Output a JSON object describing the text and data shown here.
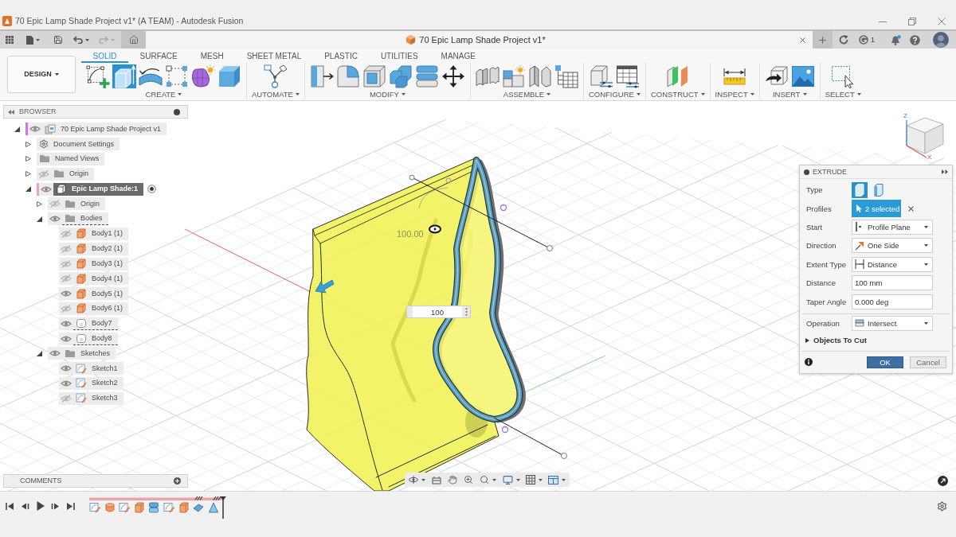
{
  "window": {
    "title": "70 Epic Lamp Shade Project v1* (A TEAM) - Autodesk Fusion"
  },
  "quick_access": {
    "undo": {
      "disabled": false
    },
    "redo": {
      "disabled": true
    }
  },
  "document_tab": {
    "title": "70 Epic Lamp Shade Project v1*"
  },
  "header_right": {
    "job_count": "1"
  },
  "workspace": {
    "label": "DESIGN"
  },
  "toolbar_tabs": [
    {
      "label": "SOLID",
      "selected": true
    },
    {
      "label": "SURFACE",
      "selected": false
    },
    {
      "label": "MESH",
      "selected": false
    },
    {
      "label": "SHEET METAL",
      "selected": false
    },
    {
      "label": "PLASTIC",
      "selected": false
    },
    {
      "label": "UTILITIES",
      "selected": false
    },
    {
      "label": "MANAGE",
      "selected": false
    }
  ],
  "tool_groups": [
    {
      "label": "CREATE",
      "tools": [
        {
          "kind": "sketch",
          "selected": false
        },
        {
          "kind": "extrude",
          "selected": true
        },
        {
          "kind": "revolve",
          "selected": false
        },
        {
          "kind": "pattern",
          "selected": false
        },
        {
          "kind": "form",
          "selected": false
        },
        {
          "kind": "box",
          "selected": false
        }
      ]
    },
    {
      "label": "AUTOMATE",
      "tools": [
        {
          "kind": "automate",
          "selected": false
        }
      ]
    },
    {
      "label": "MODIFY",
      "tools": [
        {
          "kind": "presspull",
          "selected": false
        },
        {
          "kind": "fillet",
          "selected": false
        },
        {
          "kind": "shell",
          "selected": false
        },
        {
          "kind": "combine",
          "selected": false
        },
        {
          "kind": "split",
          "selected": false
        },
        {
          "kind": "move",
          "selected": false
        }
      ]
    },
    {
      "label": "ASSEMBLE",
      "tools": [
        {
          "kind": "joint",
          "selected": false
        },
        {
          "kind": "component",
          "selected": false
        },
        {
          "kind": "rigid",
          "selected": false
        },
        {
          "kind": "table",
          "selected": false
        }
      ]
    },
    {
      "label": "CONFIGURE",
      "tools": [
        {
          "kind": "configure",
          "selected": false
        },
        {
          "kind": "configtable",
          "selected": false
        }
      ]
    },
    {
      "label": "CONSTRUCT",
      "tools": [
        {
          "kind": "plane",
          "selected": false
        }
      ]
    },
    {
      "label": "INSPECT",
      "tools": [
        {
          "kind": "measure",
          "selected": false
        }
      ]
    },
    {
      "label": "INSERT",
      "tools": [
        {
          "kind": "insert",
          "selected": false
        },
        {
          "kind": "canvas",
          "selected": false
        }
      ]
    },
    {
      "label": "SELECT",
      "tools": [
        {
          "kind": "select",
          "selected": false
        }
      ]
    }
  ],
  "browser": {
    "title": "BROWSER",
    "tree": [
      {
        "label": "70 Epic Lamp Shade Project v1",
        "kind": "document",
        "expanded": true,
        "visible": true,
        "selected": false,
        "children": [
          {
            "label": "Document Settings",
            "kind": "settings",
            "expanded": false,
            "selected": false
          },
          {
            "label": "Named Views",
            "kind": "folder",
            "expanded": false,
            "selected": false
          },
          {
            "label": "Origin",
            "kind": "folder",
            "expanded": false,
            "visible": false,
            "selected": false
          },
          {
            "label": "Epic Lamp Shade:1",
            "kind": "component",
            "expanded": true,
            "visible": true,
            "selected": true,
            "active": true,
            "children": [
              {
                "label": "Origin",
                "kind": "folder",
                "expanded": false,
                "visible": false,
                "selected": false
              },
              {
                "label": "Bodies",
                "kind": "folder",
                "expanded": true,
                "visible": true,
                "selected": false,
                "underlined": true,
                "children": [
                  {
                    "label": "Body1 (1)",
                    "kind": "solid_body",
                    "visible": false,
                    "selected": false
                  },
                  {
                    "label": "Body2 (1)",
                    "kind": "solid_body",
                    "visible": false,
                    "selected": false
                  },
                  {
                    "label": "Body3 (1)",
                    "kind": "solid_body",
                    "visible": false,
                    "selected": false
                  },
                  {
                    "label": "Body4 (1)",
                    "kind": "solid_body",
                    "visible": false,
                    "selected": false
                  },
                  {
                    "label": "Body5 (1)",
                    "kind": "solid_body",
                    "visible": true,
                    "selected": false
                  },
                  {
                    "label": "Body6 (1)",
                    "kind": "solid_body",
                    "visible": false,
                    "selected": false
                  },
                  {
                    "label": "Body7",
                    "kind": "surface_body",
                    "visible": true,
                    "selected": false,
                    "underlined": true
                  },
                  {
                    "label": "Body8",
                    "kind": "surface_body",
                    "visible": true,
                    "selected": false,
                    "underlined": true
                  }
                ]
              },
              {
                "label": "Sketches",
                "kind": "folder",
                "expanded": true,
                "visible": true,
                "selected": false,
                "children": [
                  {
                    "label": "Sketch1",
                    "kind": "sketch",
                    "visible": true,
                    "selected": false
                  },
                  {
                    "label": "Sketch2",
                    "kind": "sketch",
                    "visible": true,
                    "selected": false
                  },
                  {
                    "label": "Sketch3",
                    "kind": "sketch",
                    "visible": false,
                    "selected": false
                  }
                ]
              }
            ]
          }
        ]
      }
    ]
  },
  "viewport": {
    "dimension_label": "100.00",
    "distance_field": {
      "value": "100"
    },
    "view_cube": {
      "axes": [
        {
          "label": "Z"
        },
        {
          "label": "X"
        }
      ]
    }
  },
  "extrude": {
    "title": "EXTRUDE",
    "fields": [
      {
        "label": "Type",
        "kind": "type",
        "options": [
          {
            "selected": true
          },
          {
            "selected": false
          }
        ]
      },
      {
        "label": "Profiles",
        "kind": "selection",
        "value": "2 selected"
      },
      {
        "label": "Start",
        "kind": "dropdown",
        "value": "Profile Plane"
      },
      {
        "label": "Direction",
        "kind": "dropdown",
        "value": "One Side"
      },
      {
        "label": "Extent Type",
        "kind": "dropdown",
        "value": "Distance"
      },
      {
        "label": "Distance",
        "kind": "input",
        "value": "100 mm"
      },
      {
        "label": "Taper Angle",
        "kind": "input",
        "value": "0.000 deg"
      }
    ],
    "operation": {
      "label": "Operation",
      "value": "Intersect"
    },
    "section": {
      "label": "Objects To Cut",
      "expanded": false
    },
    "buttons": [
      {
        "label": "OK",
        "kind": "primary"
      },
      {
        "label": "Cancel",
        "kind": "secondary"
      }
    ]
  },
  "comments": {
    "title": "COMMENTS"
  },
  "timeline": {
    "features": [
      {
        "kind": "sketch"
      },
      {
        "kind": "revolve"
      },
      {
        "kind": "sketch"
      },
      {
        "kind": "body"
      },
      {
        "kind": "extrude"
      },
      {
        "kind": "sketch"
      },
      {
        "kind": "body"
      },
      {
        "kind": "surface"
      },
      {
        "kind": "loft"
      }
    ]
  }
}
